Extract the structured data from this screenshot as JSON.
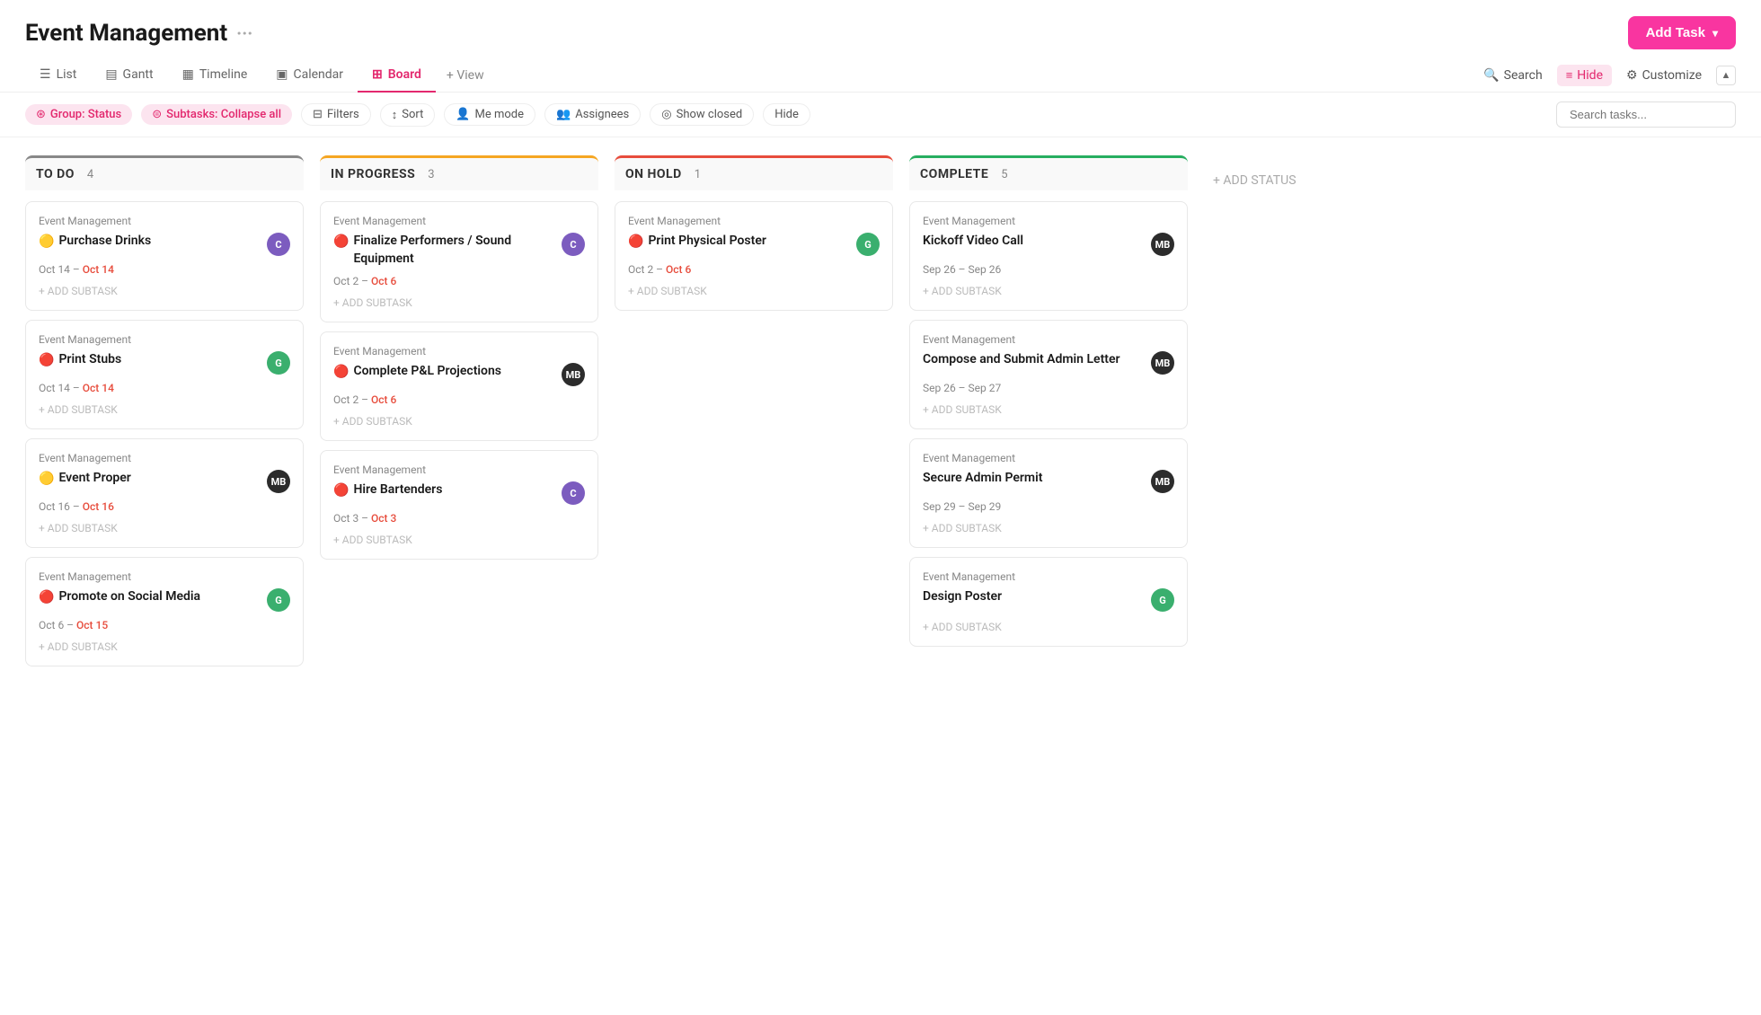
{
  "app": {
    "title": "Event Management",
    "title_dots": "···"
  },
  "header": {
    "add_task_label": "Add Task"
  },
  "tabs": [
    {
      "id": "list",
      "label": "List",
      "icon": "☰",
      "active": false
    },
    {
      "id": "gantt",
      "label": "Gantt",
      "icon": "▤",
      "active": false
    },
    {
      "id": "timeline",
      "label": "Timeline",
      "icon": "▦",
      "active": false
    },
    {
      "id": "calendar",
      "label": "Calendar",
      "icon": "▣",
      "active": false
    },
    {
      "id": "board",
      "label": "Board",
      "icon": "⊞",
      "active": true
    },
    {
      "id": "view",
      "label": "+ View",
      "icon": "",
      "active": false
    }
  ],
  "view_actions": {
    "search": "Search",
    "hide": "Hide",
    "customize": "Customize"
  },
  "filter_bar": {
    "group_status": "Group: Status",
    "subtasks_collapse": "Subtasks: Collapse all",
    "filters": "Filters",
    "sort": "Sort",
    "me_mode": "Me mode",
    "assignees": "Assignees",
    "show_closed": "Show closed",
    "hide": "Hide",
    "search_placeholder": "Search tasks..."
  },
  "columns": [
    {
      "id": "todo",
      "title": "TO DO",
      "count": 4,
      "status_class": "todo",
      "cards": [
        {
          "project": "Event Management",
          "title": "Purchase Drinks",
          "priority": "🟡",
          "avatar_initials": "C",
          "avatar_class": "purple",
          "date_start": "Oct 14",
          "date_end": "Oct 14",
          "date_end_overdue": true
        },
        {
          "project": "Event Management",
          "title": "Print Stubs",
          "priority": "🔴",
          "avatar_initials": "G",
          "avatar_class": "green",
          "date_start": "Oct 14",
          "date_end": "Oct 14",
          "date_end_overdue": true
        },
        {
          "project": "Event Management",
          "title": "Event Proper",
          "priority": "🟡",
          "avatar_initials": "MB",
          "avatar_class": "dark",
          "date_start": "Oct 16",
          "date_end": "Oct 16",
          "date_end_overdue": true
        },
        {
          "project": "Event Management",
          "title": "Promote on Social Media",
          "priority": "🔴",
          "avatar_initials": "G",
          "avatar_class": "green",
          "date_start": "Oct 6",
          "date_end": "Oct 15",
          "date_end_overdue": true
        }
      ]
    },
    {
      "id": "inprogress",
      "title": "IN PROGRESS",
      "count": 3,
      "status_class": "inprogress",
      "cards": [
        {
          "project": "Event Management",
          "title": "Finalize Performers / Sound Equipment",
          "priority": "🔴",
          "avatar_initials": "C",
          "avatar_class": "purple",
          "date_start": "Oct 2",
          "date_end": "Oct 6",
          "date_end_overdue": true
        },
        {
          "project": "Event Management",
          "title": "Complete P&L Projections",
          "priority": "🔴",
          "avatar_initials": "MB",
          "avatar_class": "dark",
          "date_start": "Oct 2",
          "date_end": "Oct 6",
          "date_end_overdue": true
        },
        {
          "project": "Event Management",
          "title": "Hire Bartenders",
          "priority": "🔴",
          "avatar_initials": "C",
          "avatar_class": "purple",
          "date_start": "Oct 3",
          "date_end": "Oct 3",
          "date_end_overdue": true
        }
      ]
    },
    {
      "id": "onhold",
      "title": "ON HOLD",
      "count": 1,
      "status_class": "onhold",
      "cards": [
        {
          "project": "Event Management",
          "title": "Print Physical Poster",
          "priority": "🔴",
          "avatar_initials": "G",
          "avatar_class": "green",
          "date_start": "Oct 2",
          "date_end": "Oct 6",
          "date_end_overdue": true
        }
      ]
    },
    {
      "id": "complete",
      "title": "COMPLETE",
      "count": 5,
      "status_class": "complete",
      "cards": [
        {
          "project": "Event Management",
          "title": "Kickoff Video Call",
          "priority": "",
          "avatar_initials": "MB",
          "avatar_class": "dark",
          "date_start": "Sep 26",
          "date_end": "Sep 26",
          "date_end_overdue": false
        },
        {
          "project": "Event Management",
          "title": "Compose and Submit Admin Letter",
          "priority": "",
          "avatar_initials": "MB",
          "avatar_class": "dark",
          "date_start": "Sep 26",
          "date_end": "Sep 27",
          "date_end_overdue": false
        },
        {
          "project": "Event Management",
          "title": "Secure Admin Permit",
          "priority": "",
          "avatar_initials": "MB",
          "avatar_class": "dark",
          "date_start": "Sep 29",
          "date_end": "Sep 29",
          "date_end_overdue": false
        },
        {
          "project": "Event Management",
          "title": "Design Poster",
          "priority": "",
          "avatar_initials": "G",
          "avatar_class": "green",
          "date_start": "",
          "date_end": "",
          "date_end_overdue": false
        }
      ]
    }
  ],
  "add_status_label": "+ ADD STATUS",
  "add_subtask_label": "+ ADD SUBTASK"
}
